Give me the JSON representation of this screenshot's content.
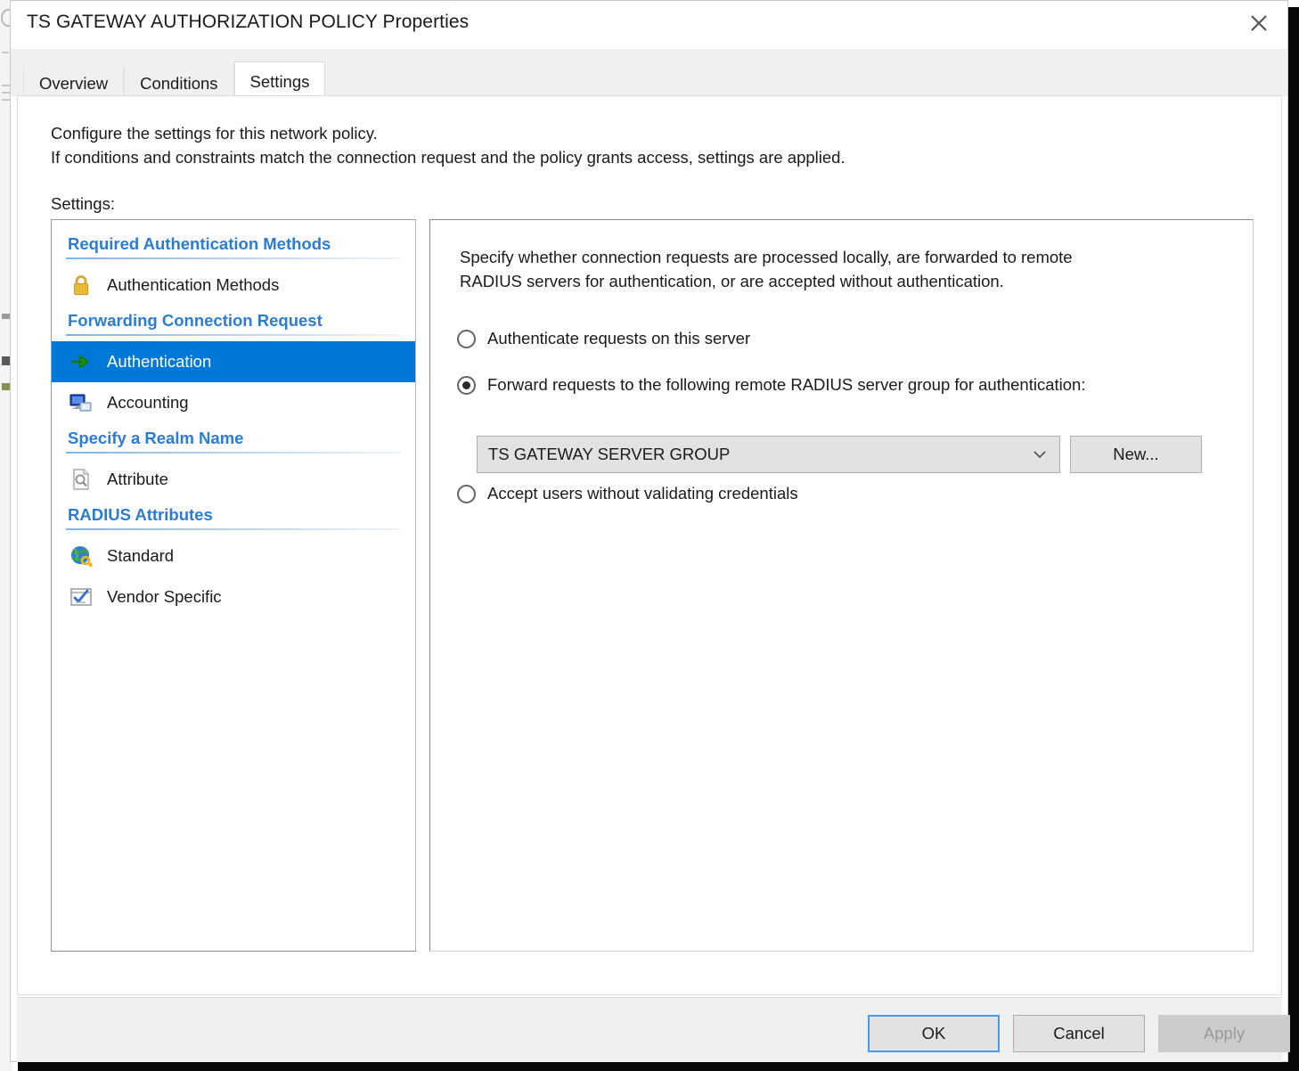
{
  "window": {
    "title": "TS GATEWAY AUTHORIZATION POLICY Properties",
    "close_icon": "close-icon"
  },
  "tabs": [
    {
      "label": "Overview",
      "active": false
    },
    {
      "label": "Conditions",
      "active": false
    },
    {
      "label": "Settings",
      "active": true
    }
  ],
  "page": {
    "description_line1": "Configure the settings for this network policy.",
    "description_line2": "If conditions and constraints match the connection request and the policy grants access, settings are applied.",
    "settings_label": "Settings:"
  },
  "tree": [
    {
      "type": "group",
      "label": "Required Authentication Methods"
    },
    {
      "type": "item",
      "label": "Authentication Methods",
      "icon": "padlock-icon",
      "selected": false
    },
    {
      "type": "group",
      "label": "Forwarding Connection Request"
    },
    {
      "type": "item",
      "label": "Authentication",
      "icon": "green-arrow-icon",
      "selected": true
    },
    {
      "type": "item",
      "label": "Accounting",
      "icon": "monitor-icon",
      "selected": false
    },
    {
      "type": "group",
      "label": "Specify a Realm Name"
    },
    {
      "type": "item",
      "label": "Attribute",
      "icon": "document-search-icon",
      "selected": false
    },
    {
      "type": "group",
      "label": "RADIUS Attributes"
    },
    {
      "type": "item",
      "label": "Standard",
      "icon": "globe-key-icon",
      "selected": false
    },
    {
      "type": "item",
      "label": "Vendor Specific",
      "icon": "checkmark-panel-icon",
      "selected": false
    }
  ],
  "detail": {
    "description_line1": "Specify whether connection requests are processed locally, are forwarded to remote",
    "description_line2": "RADIUS servers for authentication, or are accepted without authentication.",
    "options": [
      {
        "label": "Authenticate requests on this server",
        "selected": false
      },
      {
        "label": "Forward requests to the following remote RADIUS server group for authentication:",
        "selected": true
      },
      {
        "label": "Accept users without validating credentials",
        "selected": false
      }
    ],
    "server_group_combo": {
      "value": "TS GATEWAY SERVER GROUP",
      "chevron_icon": "chevron-down-icon"
    },
    "new_button_label": "New..."
  },
  "footer": {
    "ok_label": "OK",
    "cancel_label": "Cancel",
    "apply_label": "Apply",
    "apply_disabled": true
  },
  "colors": {
    "selection_blue": "#0078D7",
    "heading_blue": "#2B7CD3",
    "focus_border": "#4A9AE0",
    "window_bg": "#FFFFFF",
    "chrome_grey": "#F0F0F0"
  }
}
